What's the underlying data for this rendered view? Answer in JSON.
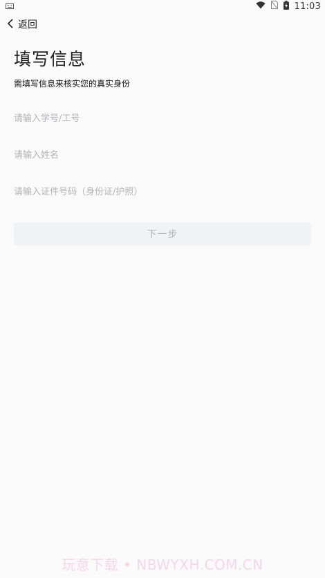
{
  "status_bar": {
    "time": "11:03",
    "icons": [
      "keyboard-icon",
      "wifi-icon",
      "no-sim-icon",
      "battery-charging-icon"
    ]
  },
  "header": {
    "back_label": "返回"
  },
  "page": {
    "title": "填写信息",
    "subtitle": "需填写信息来核实您的真实身份"
  },
  "form": {
    "id_placeholder": "请输入学号/工号",
    "name_placeholder": "请输入姓名",
    "document_placeholder": "请输入证件号码（身份证/护照）",
    "next_label": "下一步"
  },
  "watermark": "玩意下载 • NBWYXH.COM.CN",
  "colors": {
    "background": "#fafafa",
    "button_bg": "#f1f2f6",
    "placeholder": "#b3b3b8"
  }
}
